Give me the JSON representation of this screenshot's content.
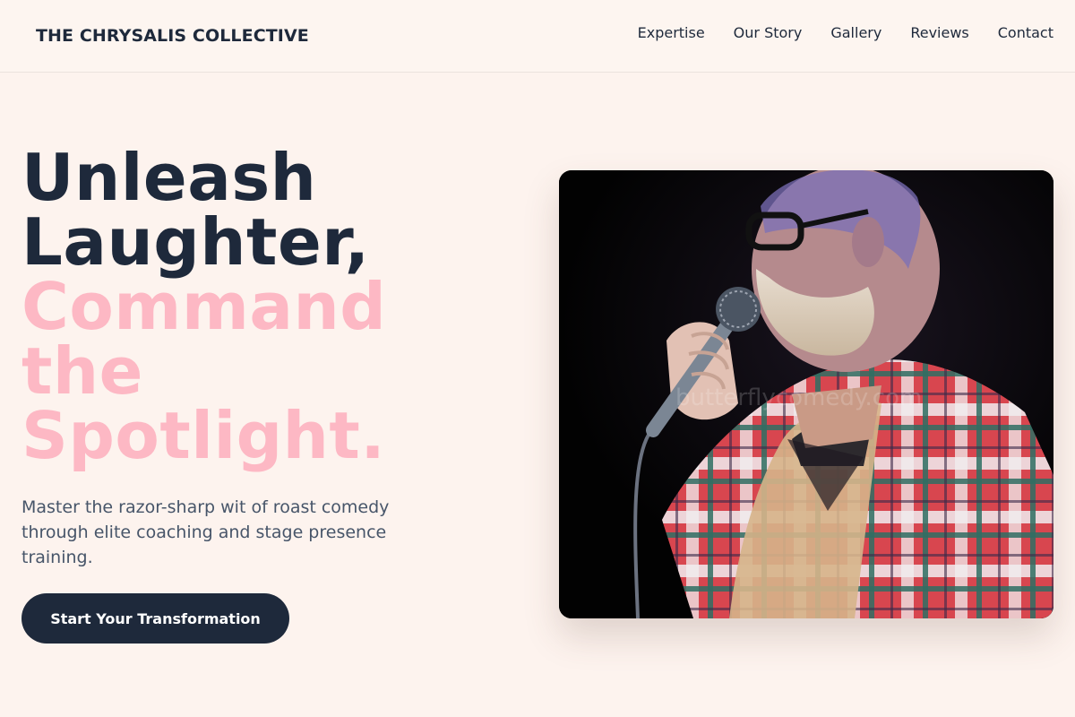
{
  "header": {
    "brand": "THE CHRYSALIS COLLECTIVE",
    "nav": [
      "Expertise",
      "Our Story",
      "Gallery",
      "Reviews",
      "Contact"
    ]
  },
  "hero": {
    "headline_dark": [
      "Unleash",
      "Laughter,"
    ],
    "headline_pink": [
      "Command",
      "the",
      "Spotlight."
    ],
    "subtitle": "Master the razor-sharp wit of roast comedy through elite coaching and stage presence training.",
    "cta_label": "Start Your Transformation",
    "image_watermark": "butterflycomedy.com"
  },
  "colors": {
    "background": "#fdf3ee",
    "navy": "#1e293b",
    "pink_accent": "#fdb8c4",
    "body_text": "#475569"
  }
}
